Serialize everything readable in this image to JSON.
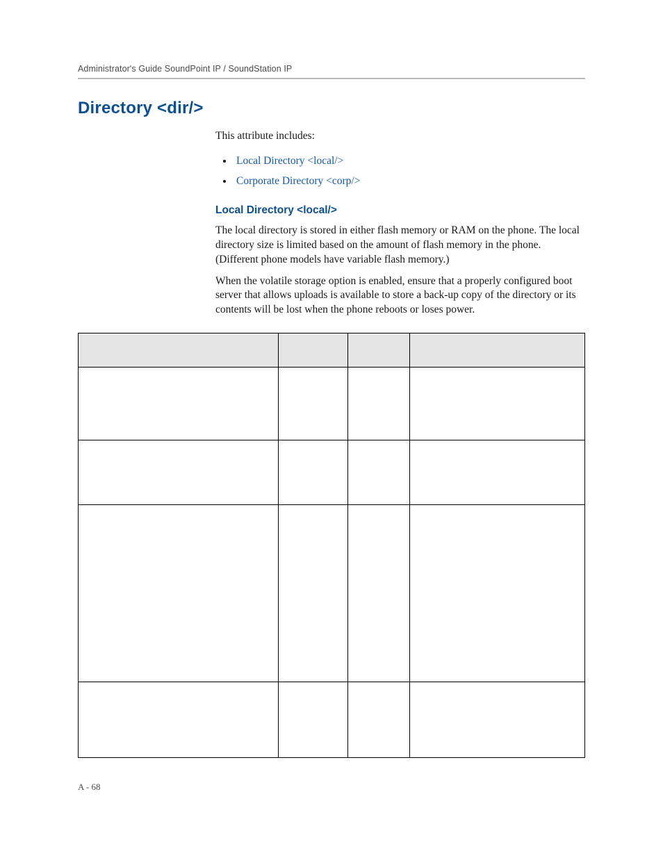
{
  "runningHeader": "Administrator's Guide SoundPoint IP / SoundStation IP",
  "title": "Directory <dir/>",
  "intro": "This attribute includes:",
  "links": [
    "Local Directory <local/>",
    "Corporate Directory <corp/>"
  ],
  "subheading": "Local Directory <local/>",
  "para1": "The local directory is stored in either flash memory or RAM on the phone. The local directory size is limited based on the amount of flash memory in the phone. (Different phone models have variable flash memory.)",
  "para2": "When the volatile storage option is enabled, ensure that a properly configured boot server that allows uploads is available to store a back-up copy of the directory or its contents will be lost when the phone reboots or loses power.",
  "pageNumber": "A - 68"
}
